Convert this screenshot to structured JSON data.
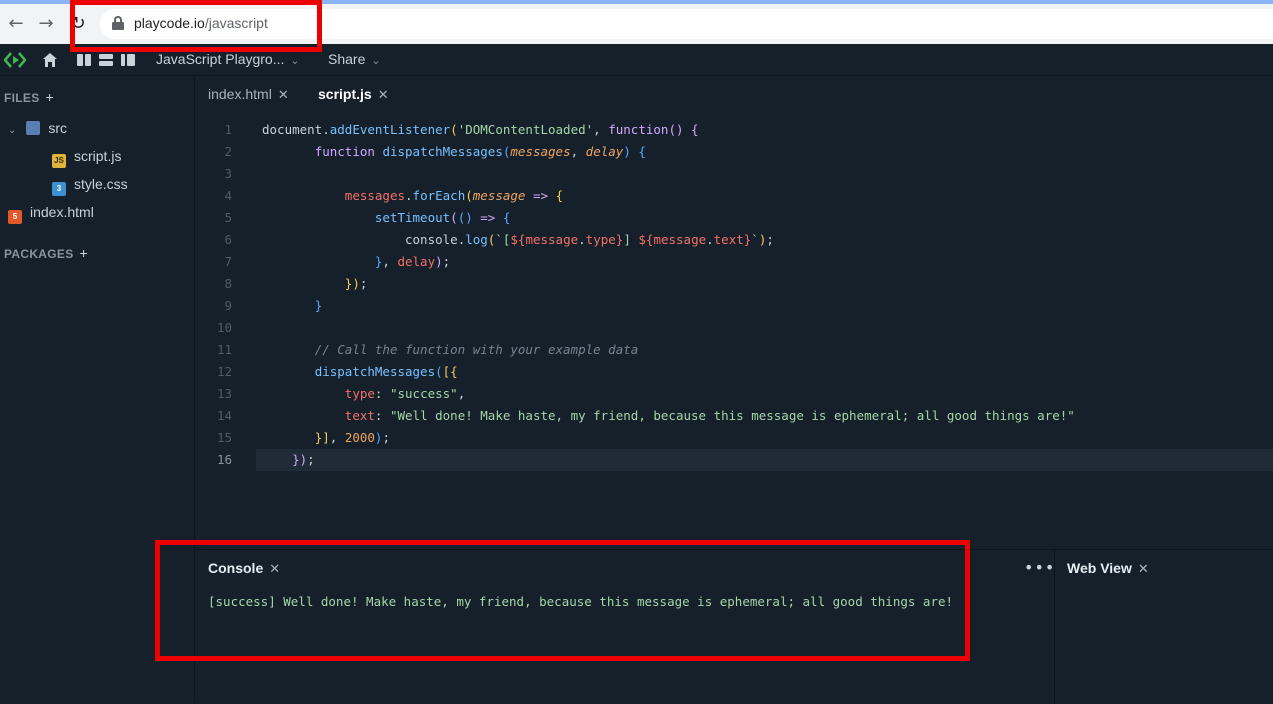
{
  "browser": {
    "url_host": "playcode.io",
    "url_path": "/javascript"
  },
  "topbar": {
    "title": "JavaScript Playgro...",
    "share_label": "Share"
  },
  "sidebar": {
    "files_heading": "FILES",
    "packages_heading": "PACKAGES",
    "add_symbol": "+",
    "folder": "src",
    "files": [
      "script.js",
      "style.css"
    ],
    "root_file": "index.html"
  },
  "tabs": [
    {
      "label": "index.html",
      "active": false
    },
    {
      "label": "script.js",
      "active": true
    }
  ],
  "close_symbol": "✕",
  "editor": {
    "line_numbers": [
      "1",
      "2",
      "3",
      "4",
      "5",
      "6",
      "7",
      "8",
      "9",
      "10",
      "11",
      "12",
      "13",
      "14",
      "15",
      "16"
    ],
    "current_line": 16
  },
  "console": {
    "title": "Console",
    "output": "[success] Well done! Make haste, my friend, because this message is ephemeral; all good things are!"
  },
  "webview": {
    "title": "Web View"
  },
  "colors": {
    "background": "#15202b",
    "highlight_box": "#ee0000",
    "console_text": "#a5d6a7"
  }
}
